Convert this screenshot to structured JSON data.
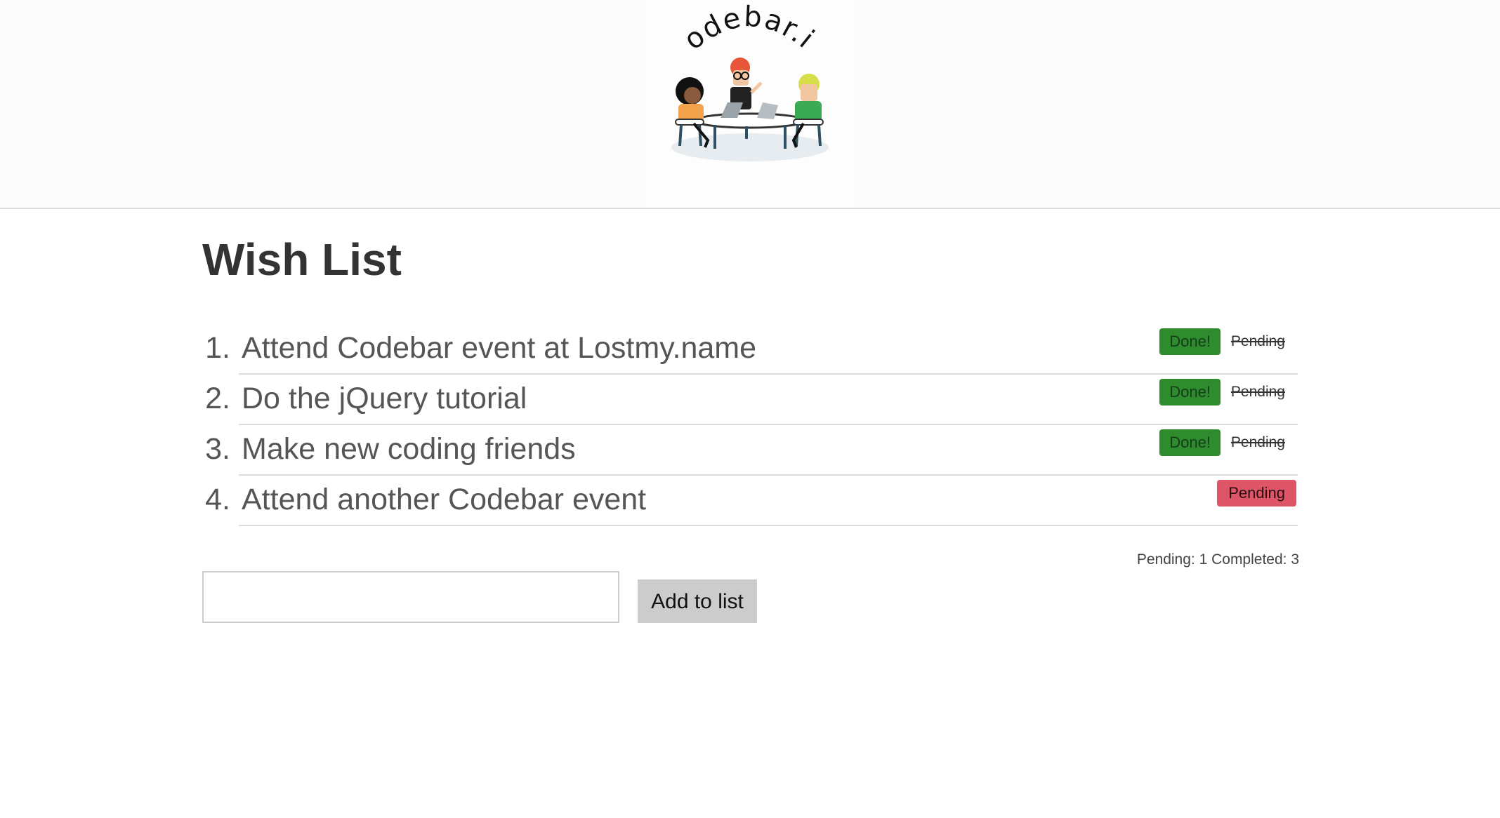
{
  "header": {
    "logo_text": "codebar.io"
  },
  "page": {
    "title": "Wish List"
  },
  "wish_list": {
    "items": [
      {
        "number": "1.",
        "text": "Attend Codebar event at Lostmy.name",
        "status": "done",
        "done_label": "Done!",
        "pending_label": "Pending"
      },
      {
        "number": "2.",
        "text": "Do the jQuery tutorial",
        "status": "done",
        "done_label": "Done!",
        "pending_label": "Pending"
      },
      {
        "number": "3.",
        "text": "Make new coding friends",
        "status": "done",
        "done_label": "Done!",
        "pending_label": "Pending"
      },
      {
        "number": "4.",
        "text": "Attend another Codebar event",
        "status": "pending",
        "pending_label": "Pending"
      }
    ]
  },
  "summary": {
    "text": "Pending: 1 Completed: 3"
  },
  "form": {
    "input_value": "",
    "input_placeholder": "",
    "add_label": "Add to list"
  },
  "colors": {
    "done": "#2e8b2e",
    "pending": "#dd5566",
    "add_button": "#cccccc"
  }
}
